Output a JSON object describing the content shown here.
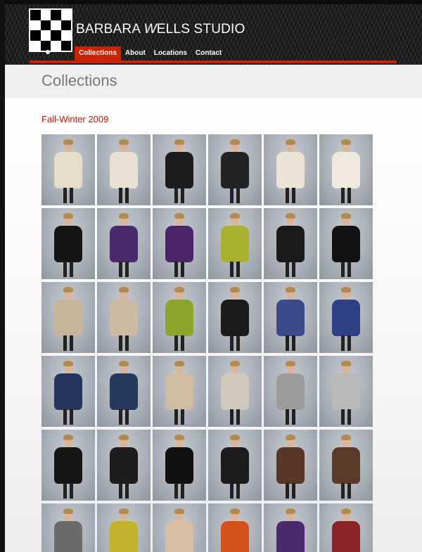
{
  "brand": {
    "name_part1": "BARBARA ",
    "name_italic": "W",
    "name_part2": "ELLS STUDIO",
    "logo_icon": "checkerboard-logo-icon"
  },
  "nav": {
    "items": [
      {
        "label": "Collections",
        "active": true
      },
      {
        "label": "About",
        "active": false
      },
      {
        "label": "Locations",
        "active": false
      },
      {
        "label": "Contact",
        "active": false
      }
    ]
  },
  "page": {
    "title": "Collections",
    "section_title": "Fall-Winter 2009"
  },
  "colors": {
    "accent": "#cc2200",
    "section_title": "#cc1a00",
    "header_bg": "#1d1d1d"
  },
  "gallery": {
    "rows": 6,
    "columns": 6,
    "garment_colors": [
      "#e6dccb",
      "#e9e1d2",
      "#1c1c1c",
      "#222222",
      "#ebe3d3",
      "#efe9dd",
      "#151515",
      "#4a2a6a",
      "#4c2568",
      "#a8b030",
      "#1a1a1a",
      "#121212",
      "#c7b59c",
      "#cdbba3",
      "#8ea52c",
      "#1a1a1a",
      "#3a4a8a",
      "#2e3f86",
      "#27355e",
      "#25385e",
      "#d2bba3",
      "#d0cabd",
      "#9c9c9c",
      "#b9b9b9",
      "#161616",
      "#1d1d1d",
      "#111111",
      "#1c1c1c",
      "#5a3628",
      "#5c3a2a",
      "#6b6b6b",
      "#c4b22a",
      "#d9bfa6",
      "#d6501e",
      "#4a2a6a",
      "#8a2228"
    ]
  }
}
